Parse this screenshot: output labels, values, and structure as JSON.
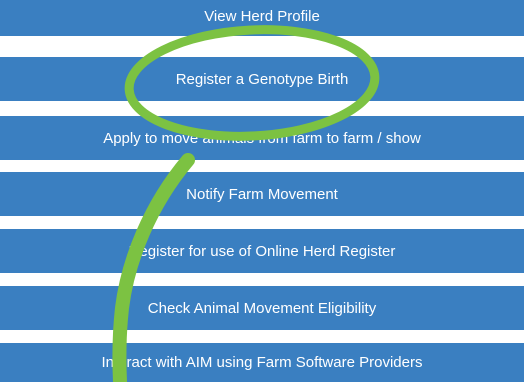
{
  "menu": {
    "items": [
      {
        "label": "View Herd Profile"
      },
      {
        "label": "Register a Genotype Birth"
      },
      {
        "label": "Apply to move animals from farm to farm / show"
      },
      {
        "label": "Notify Farm Movement"
      },
      {
        "label": "Register for use of Online Herd Register"
      },
      {
        "label": "Check Animal Movement Eligibility"
      },
      {
        "label": "Interact with AIM using Farm Software Providers"
      }
    ]
  },
  "annotation": {
    "color": "#7cc242",
    "highlighted_item": "Register a Genotype Birth"
  },
  "colors": {
    "button_bg": "#3a7fc1",
    "button_text": "#ffffff",
    "background": "#ffffff"
  }
}
